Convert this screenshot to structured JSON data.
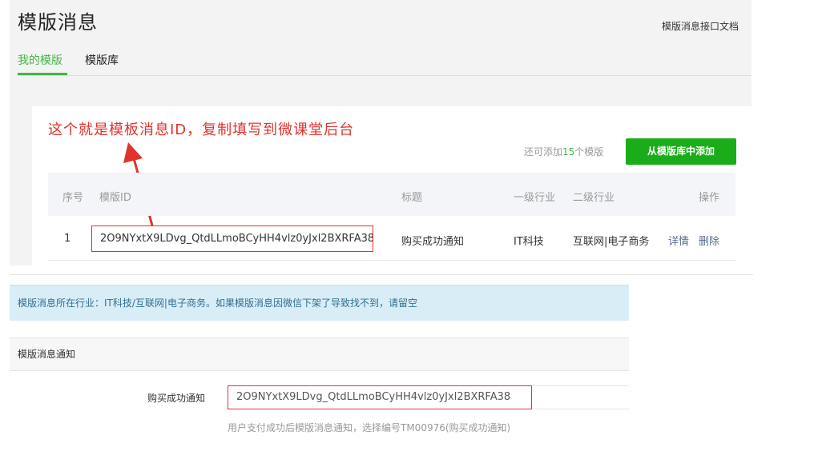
{
  "header": {
    "title": "模版消息",
    "doc_link": "模版消息接口文档"
  },
  "tabs": [
    {
      "label": "我的模版",
      "active": true
    },
    {
      "label": "模版库",
      "active": false
    }
  ],
  "annotation": "这个就是模板消息ID，复制填写到微课堂后台",
  "quota": {
    "prefix": "还可添加",
    "count": "15",
    "suffix": "个模版"
  },
  "add_button": "从模版库中添加",
  "table": {
    "headers": {
      "index": "序号",
      "template_id": "模版ID",
      "title": "标题",
      "industry1": "一级行业",
      "industry2": "二级行业",
      "actions": "操作"
    },
    "rows": [
      {
        "index": "1",
        "template_id": "2O9NYxtX9LDvg_QtdLLmoBCyHH4vlz0yJxl2BXRFA38",
        "title": "购买成功通知",
        "industry1": "IT科技",
        "industry2": "互联网|电子商务",
        "detail": "详情",
        "delete": "删除"
      }
    ]
  },
  "info_text": "模版消息所在行业：IT科技/互联网|电子商务。如果模版消息因微信下架了导致找不到，请留空",
  "section_title": "模版消息通知",
  "form": {
    "label": "购买成功通知",
    "value": "2O9NYxtX9LDvg_QtdLLmoBCyHH4vlz0yJxl2BXRFA38",
    "help": "用户支付成功后模版消息通知，选择编号TM00976(购买成功通知)"
  },
  "colors": {
    "accent_green": "#44b549",
    "button_green": "#1aad19",
    "annotation_red": "#e0332d",
    "info_bg": "#d9edf7"
  }
}
